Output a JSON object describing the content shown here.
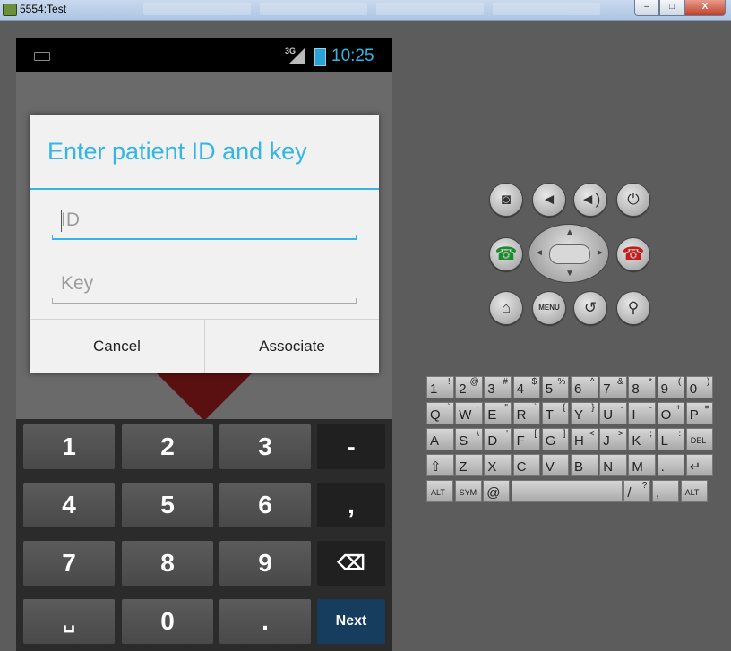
{
  "window": {
    "title": "5554:Test",
    "minimize": "–",
    "maximize": "□",
    "close": "X"
  },
  "status_bar": {
    "network": "3G",
    "time": "10:25"
  },
  "dialog": {
    "title": "Enter patient ID and key",
    "id_placeholder": "ID",
    "key_placeholder": "Key",
    "cancel_label": "Cancel",
    "associate_label": "Associate"
  },
  "numpad": {
    "keys": [
      "1",
      "2",
      "3",
      "-",
      "4",
      "5",
      "6",
      ",",
      "7",
      "8",
      "9",
      "⌫",
      "␣",
      "0",
      ".",
      "Next"
    ]
  },
  "controls": {
    "menu_label": "MENU"
  },
  "qwerty": {
    "rows": [
      [
        [
          "1",
          "!"
        ],
        [
          "2",
          "@"
        ],
        [
          "3",
          "#"
        ],
        [
          "4",
          "$"
        ],
        [
          "5",
          "%"
        ],
        [
          "6",
          "^"
        ],
        [
          "7",
          "&"
        ],
        [
          "8",
          "*"
        ],
        [
          "9",
          "("
        ],
        [
          "0",
          ")"
        ]
      ],
      [
        [
          "Q",
          "`"
        ],
        [
          "W",
          "~"
        ],
        [
          "E",
          "\""
        ],
        [
          "R",
          "`"
        ],
        [
          "T",
          "{"
        ],
        [
          "Y",
          "}"
        ],
        [
          "U",
          "-"
        ],
        [
          "I",
          "-"
        ],
        [
          "O",
          "+"
        ],
        [
          "P",
          "="
        ]
      ],
      [
        [
          "A",
          ""
        ],
        [
          "S",
          "\\"
        ],
        [
          "D",
          "'"
        ],
        [
          "F",
          "["
        ],
        [
          "G",
          "]"
        ],
        [
          "H",
          "<"
        ],
        [
          "J",
          ">"
        ],
        [
          "K",
          ";"
        ],
        [
          "L",
          ":"
        ],
        [
          "DEL",
          ""
        ]
      ],
      [
        [
          "⇧",
          ""
        ],
        [
          "Z",
          ""
        ],
        [
          "X",
          ""
        ],
        [
          "C",
          ""
        ],
        [
          "V",
          ""
        ],
        [
          "B",
          ""
        ],
        [
          "N",
          ""
        ],
        [
          "M",
          ""
        ],
        [
          ".",
          ""
        ],
        [
          "↵",
          ""
        ]
      ],
      [
        [
          "ALT",
          ""
        ],
        [
          "SYM",
          ""
        ],
        [
          "@",
          ""
        ],
        [
          "",
          ""
        ],
        [
          "/",
          "?"
        ],
        [
          ",",
          ""
        ],
        [
          "ALT",
          ""
        ]
      ]
    ]
  }
}
